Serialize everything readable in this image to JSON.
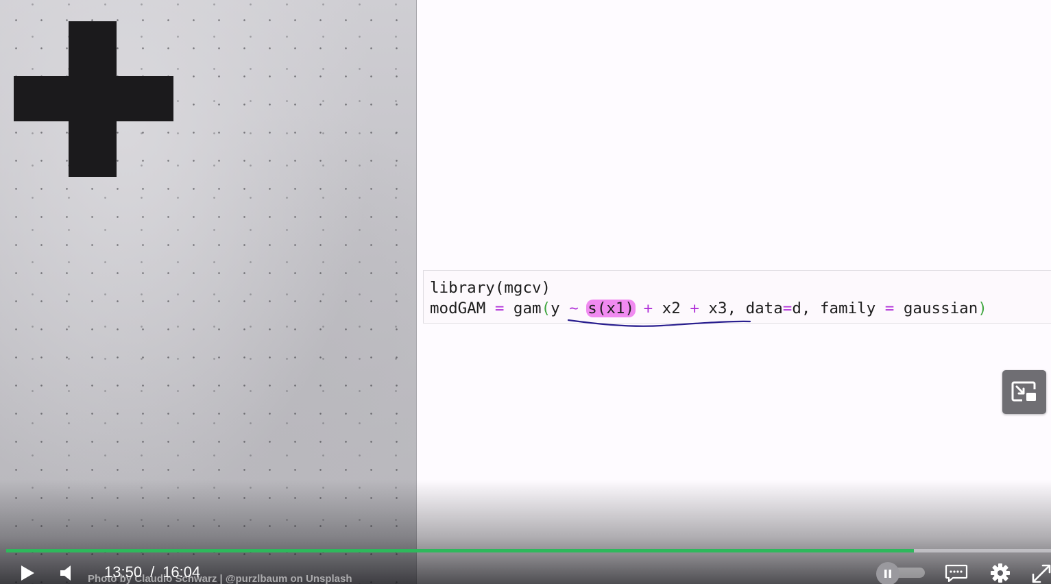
{
  "photo": {
    "credit": "Photo by Claudio Schwarz | @purzlbaum on Unsplash"
  },
  "code": {
    "line1": "library(mgcv)",
    "line2_parts": {
      "p1": "modGAM ",
      "eq1": "=",
      "p2": " gam",
      "lp": "(",
      "p3": "y ",
      "tilde": "~",
      "p4": " ",
      "hl": "s(x1)",
      "p5": " ",
      "plus1": "+",
      "p6": " x2 ",
      "plus2": "+",
      "p7": " x3, data",
      "eq2": "=",
      "p8": "d, family ",
      "eq3": "=",
      "p9": " gaussian",
      "rp": ")"
    },
    "highlight_color": "#f08af0",
    "operator_color": "#b030d8",
    "paren_color": "#3fa63f"
  },
  "player": {
    "current_time": "13:50",
    "separator": "/",
    "duration": "16:04",
    "progress_fraction": 0.869,
    "progress_color": "#2eb85c",
    "icons": {
      "play": "play-icon",
      "volume": "volume-icon",
      "rate_pause": "pause-icon",
      "captions": "captions-icon",
      "settings": "gear-icon",
      "fullscreen": "fullscreen-icon",
      "pip": "picture-in-picture-icon"
    }
  }
}
